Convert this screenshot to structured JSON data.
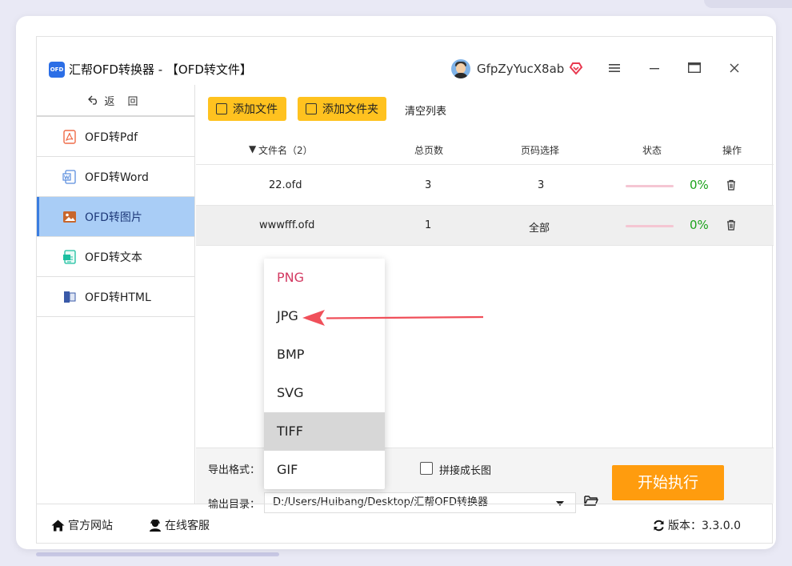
{
  "window": {
    "logo_text": "OFD",
    "title": "汇帮OFD转换器 - 【OFD转文件】",
    "username": "GfpZyYucX8ab"
  },
  "colors": {
    "accent_yellow": "#ffc21f",
    "start_orange": "#ff9c0e",
    "active_nav": "#a9cdf6",
    "percent_green": "#1da31d",
    "dropdown_selected": "#d33a62",
    "annotation_arrow": "#f0505a"
  },
  "sidebar": {
    "back_label": "返 回",
    "items": [
      {
        "label": "OFD转Pdf",
        "icon": "pdf-icon"
      },
      {
        "label": "OFD转Word",
        "icon": "word-icon"
      },
      {
        "label": "OFD转图片",
        "icon": "image-icon",
        "active": true
      },
      {
        "label": "OFD转文本",
        "icon": "text-icon"
      },
      {
        "label": "OFD转HTML",
        "icon": "html-icon"
      }
    ]
  },
  "toolbar": {
    "add_file": "添加文件",
    "add_folder": "添加文件夹",
    "clear_list": "清空列表"
  },
  "table": {
    "headers": {
      "filename": "文件名（2）",
      "pages": "总页数",
      "page_select": "页码选择",
      "status": "状态",
      "action": "操作"
    },
    "rows": [
      {
        "filename": "22.ofd",
        "pages": "3",
        "page_select": "3",
        "status": "0%",
        "progress": 0
      },
      {
        "filename": "wwwfff.ofd",
        "pages": "1",
        "page_select": "全部",
        "status": "0%",
        "progress": 0
      }
    ]
  },
  "bottom": {
    "format_label": "导出格式：",
    "merge_label": "拼接成长图",
    "merge_checked": false,
    "dir_label": "输出目录：",
    "dir_value": "D:/Users/Huibang/Desktop/汇帮OFD转换器",
    "start_button": "开始执行"
  },
  "footer": {
    "website": "官方网站",
    "support": "在线客服",
    "version": "版本：3.3.0.0"
  },
  "format_dropdown": {
    "options": [
      "PNG",
      "JPG",
      "BMP",
      "SVG",
      "TIFF",
      "GIF"
    ],
    "selected": "PNG",
    "hovered": "TIFF"
  }
}
